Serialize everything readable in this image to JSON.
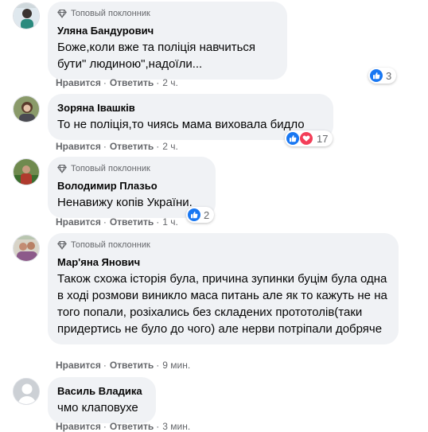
{
  "colors": {
    "bubble": "#f0f2f5",
    "like": "#1877f2",
    "love": "#f33e58",
    "meta": "#65676b"
  },
  "comments": [
    {
      "badge": "Топовый поклонник",
      "name": "Уляна Бандурович",
      "text": "Боже,коли вже та поліція навчиться бути\" людиною\",надоїли...",
      "like": "Нравится",
      "reply": "Ответить",
      "time": "2 ч.",
      "reactions": {
        "icons": [
          "like-icon"
        ],
        "count": "3"
      }
    },
    {
      "name": "Зоряна Івашків",
      "text": "То не поліція,то чиясь мама виховала бидло",
      "like": "Нравится",
      "reply": "Ответить",
      "time": "2 ч.",
      "reactions": {
        "icons": [
          "like-icon",
          "love-icon"
        ],
        "count": "17"
      }
    },
    {
      "badge": "Топовый поклонник",
      "name": "Володимир Плазьо",
      "text": "Ненавижу копів України.",
      "like": "Нравится",
      "reply": "Ответить",
      "time": "1 ч.",
      "reactions": {
        "icons": [
          "like-icon"
        ],
        "count": "2"
      }
    },
    {
      "badge": "Топовый поклонник",
      "name": "Мар'яна Янович",
      "text": "Також схожа історія була, причина зупинки буцім була одна в ході розмови виникло маса питань але як то кажуть не на того попали, розіхались без складених прототолів(таки придертись не було до чого) але нерви потріпали добряче",
      "like": "Нравится",
      "reply": "Ответить",
      "time": "9 мин."
    },
    {
      "name": "Василь Владика",
      "text": "чмо клаповухе",
      "like": "Нравится",
      "reply": "Ответить",
      "time": "3 мин."
    }
  ]
}
